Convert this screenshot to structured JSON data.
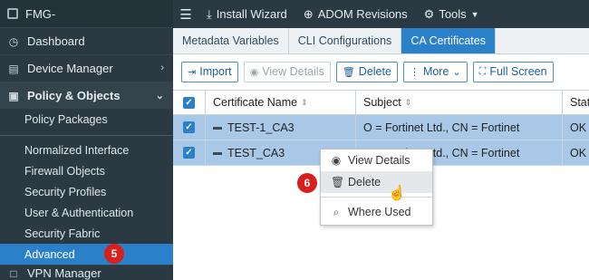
{
  "sidebar": {
    "brand": "FMG-",
    "items": [
      {
        "label": "Dashboard",
        "icon": "dashboard-icon"
      },
      {
        "label": "Device Manager",
        "icon": "device-manager-icon"
      },
      {
        "label": "Policy & Objects",
        "icon": "policy-icon"
      }
    ],
    "policy_sub_top": "Policy Packages",
    "object_sub": [
      "Normalized Interface",
      "Firewall Objects",
      "Security Profiles",
      "User & Authentication",
      "Security Fabric",
      "Advanced"
    ],
    "next_item": "VPN Manager",
    "step_badge": "5"
  },
  "topbar": {
    "install_wizard": "Install Wizard",
    "adom_revisions": "ADOM Revisions",
    "tools": "Tools"
  },
  "tabs": [
    "Metadata Variables",
    "CLI Configurations",
    "CA Certificates"
  ],
  "active_tab": "CA Certificates",
  "toolbar": {
    "import": "Import",
    "view_details": "View Details",
    "delete": "Delete",
    "more": "More",
    "full_screen": "Full Screen"
  },
  "table": {
    "columns": [
      "Certificate Name",
      "Subject",
      "Status"
    ],
    "status_header_visible": "Statu",
    "rows": [
      {
        "name": "TEST-1_CA3",
        "subject": "O = Fortinet Ltd., CN = Fortinet",
        "status": "OK"
      },
      {
        "name": "TEST_CA3",
        "subject": "O = Fortinet Ltd., CN = Fortinet",
        "status": "OK"
      }
    ]
  },
  "context_menu": {
    "items": [
      "View Details",
      "Delete",
      "Where Used"
    ],
    "step_badge": "6"
  },
  "colors": {
    "sidebar_bg": "#2b3a42",
    "accent_blue": "#2a81c9",
    "row_selected": "#a9c7e6",
    "badge_red": "#d91e1e"
  }
}
